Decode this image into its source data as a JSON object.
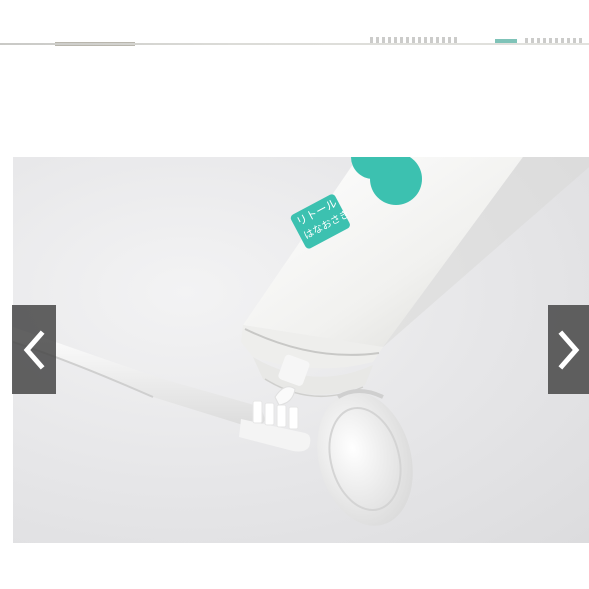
{
  "gallery": {
    "prev_icon": "chevron-left-icon",
    "next_icon": "chevron-right-icon"
  },
  "product": {
    "label_line1": "リトール",
    "label_line2": "はなおさき",
    "accent_color": "#3cc1b0",
    "tube_color": "#f4f4f2"
  }
}
